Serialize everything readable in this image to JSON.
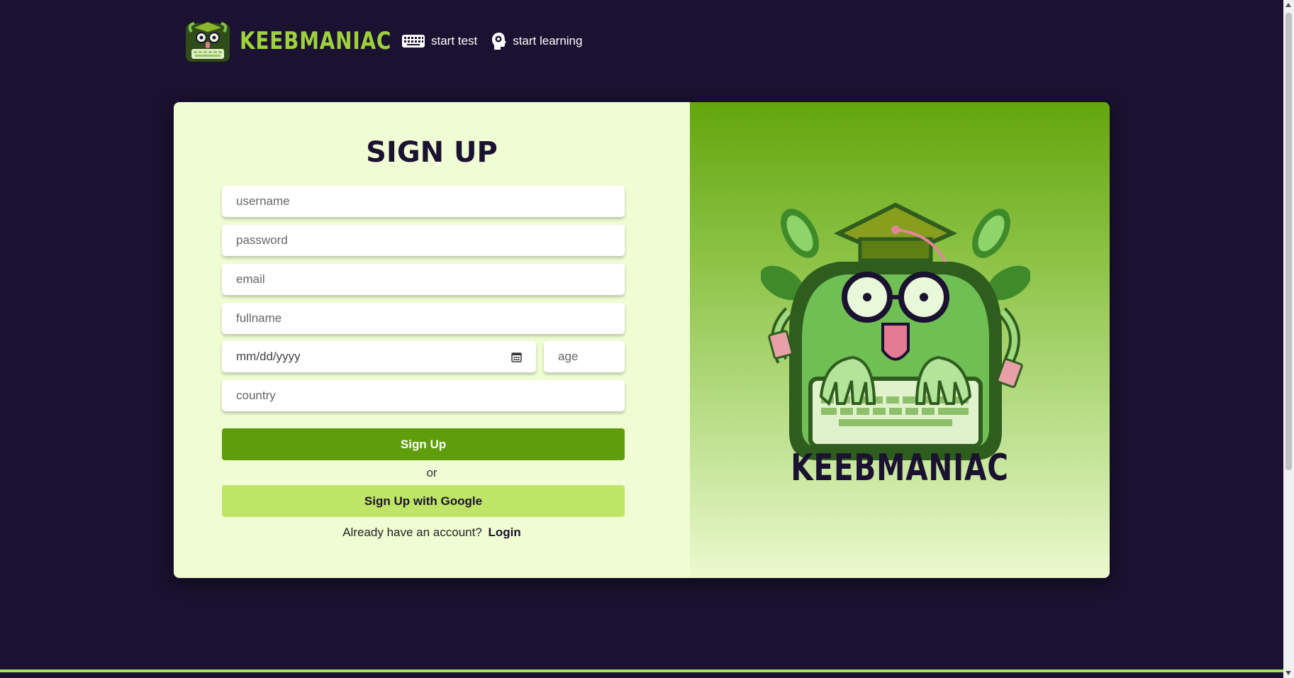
{
  "header": {
    "logo_text": "KEEBMANIAC",
    "nav": [
      {
        "label": "start test",
        "icon": "keyboard-icon"
      },
      {
        "label": "start learning",
        "icon": "brain-head-icon"
      }
    ]
  },
  "form": {
    "title": "SIGN UP",
    "fields": {
      "username": {
        "placeholder": "username",
        "value": ""
      },
      "password": {
        "placeholder": "password",
        "value": ""
      },
      "email": {
        "placeholder": "email",
        "value": ""
      },
      "fullname": {
        "placeholder": "fullname",
        "value": ""
      },
      "birthdate": {
        "placeholder": "mm/dd/yyyy",
        "value": ""
      },
      "age": {
        "placeholder": "age",
        "value": ""
      },
      "country": {
        "placeholder": "country",
        "value": ""
      }
    },
    "signup_button": "Sign Up",
    "or_text": "or",
    "google_button": "Sign Up with Google",
    "login_prompt": "Already have an account?",
    "login_link": "Login"
  },
  "hero": {
    "brand_text": "KEEBMANIAC"
  },
  "colors": {
    "background": "#1b1130",
    "accent_green": "#5e9e0c",
    "light_green": "#bfe566",
    "form_bg": "#f0fdd4",
    "logo_green": "#9ed23c"
  }
}
